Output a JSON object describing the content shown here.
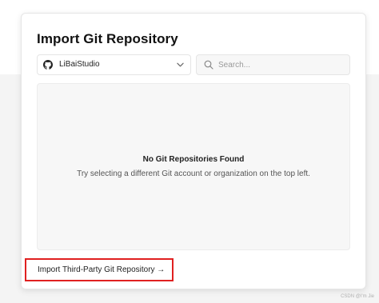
{
  "dialog": {
    "title": "Import Git Repository",
    "account_select": {
      "selected": "LiBaiStudio",
      "provider_icon": "github-icon"
    },
    "search": {
      "placeholder": "Search..."
    },
    "empty_state": {
      "title": "No Git Repositories Found",
      "message": "Try selecting a different Git account or organization on the top left."
    },
    "third_party_link": "Import Third-Party Git Repository →"
  },
  "watermark": "CSDN @I'm Jie",
  "colors": {
    "highlight_border": "#e02020",
    "panel_background": "#f7f7f7"
  }
}
